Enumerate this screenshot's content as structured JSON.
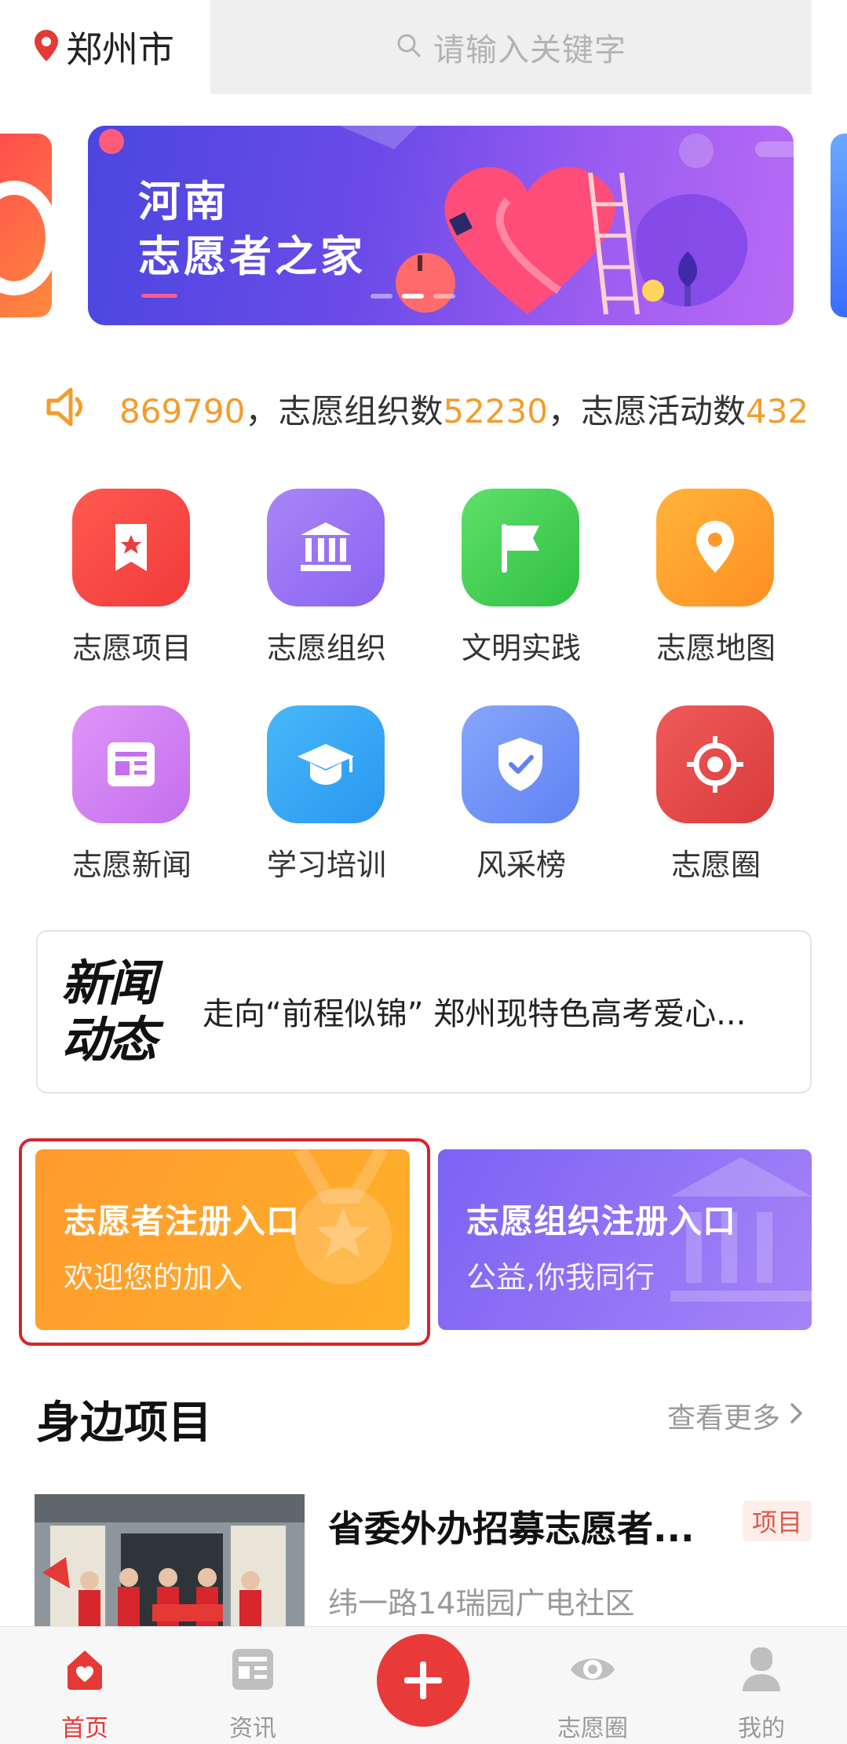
{
  "header": {
    "city": "郑州市",
    "search_placeholder": "请输入关键字"
  },
  "banner": {
    "line1": "河南",
    "line2": "志愿者之家",
    "active_index": 1,
    "dot_count": 3
  },
  "ticker": {
    "prefix": "869790",
    "sep1": "，志愿组织数",
    "org_count": "52230",
    "sep2": "，志愿活动数",
    "activity_count": "432"
  },
  "grid": [
    {
      "label": "志愿项目",
      "icon": "bookmark-star-icon",
      "color": "#f5403f"
    },
    {
      "label": "志愿组织",
      "icon": "building-icon",
      "color": "#9b74f5"
    },
    {
      "label": "文明实践",
      "icon": "flag-icon",
      "color": "#3ccf4e"
    },
    {
      "label": "志愿地图",
      "icon": "map-pin-icon",
      "color": "#ffa22e"
    },
    {
      "label": "志愿新闻",
      "icon": "newspaper-icon",
      "color": "#d382f2"
    },
    {
      "label": "学习培训",
      "icon": "graduation-cap-icon",
      "color": "#31a6f5"
    },
    {
      "label": "风采榜",
      "icon": "shield-check-icon",
      "color": "#6f92f7"
    },
    {
      "label": "志愿圈",
      "icon": "target-icon",
      "color": "#e64b4b"
    }
  ],
  "news": {
    "logo_line1": "新闻",
    "logo_line2": "动态",
    "headline": "走向“前程似锦” 郑州现特色高考爱心..."
  },
  "register": {
    "volunteer": {
      "title": "志愿者注册入口",
      "subtitle": "欢迎您的加入"
    },
    "organization": {
      "title": "志愿组织注册入口",
      "subtitle": "公益,你我同行"
    }
  },
  "nearby": {
    "title": "身边项目",
    "more": "查看更多",
    "items": [
      {
        "title": "省委外办招募志愿者...",
        "tag": "项目",
        "address": "纬一路14瑞园广电社区"
      }
    ]
  },
  "tabbar": {
    "items": [
      {
        "label": "首页",
        "icon": "home-icon",
        "active": true
      },
      {
        "label": "资讯",
        "icon": "news-icon",
        "active": false
      },
      {
        "label": "志愿圈",
        "icon": "eye-icon",
        "active": false
      },
      {
        "label": "我的",
        "icon": "user-icon",
        "active": false
      }
    ],
    "fab_icon": "plus-icon"
  },
  "colors": {
    "accent": "#e53935",
    "ticker_number": "#f39c2c",
    "highlight_border": "#d6252b"
  }
}
